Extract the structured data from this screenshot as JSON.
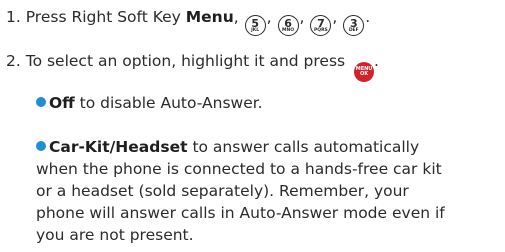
{
  "step1": {
    "number": "1.",
    "text": "Press Right Soft Key",
    "key_label": "Menu",
    "keys": [
      {
        "digit": "5",
        "letters": "JKL"
      },
      {
        "digit": "6",
        "letters": "MNO"
      },
      {
        "digit": "7",
        "letters": "PQRS"
      },
      {
        "digit": "3",
        "letters": "DEF"
      }
    ],
    "separator": ",",
    "end": "."
  },
  "step2": {
    "number": "2.",
    "text": "To select an option, highlight it and press",
    "menu_key": {
      "top": "MENU",
      "bottom": "OK"
    },
    "end": "."
  },
  "options": [
    {
      "label": "Off",
      "description": "to disable Auto-Answer."
    },
    {
      "label": "Car-Kit/Headset",
      "lines": [
        "to answer calls automatically",
        "when the phone is connected to a hands-free car kit",
        "or a headset (sold separately). Remember, your",
        "phone will answer calls in Auto-Answer mode even if",
        "you are not present."
      ]
    }
  ],
  "colors": {
    "bullet": "#1e8fd6",
    "menu_key": "#d2232a",
    "text": "#2b2b2b"
  }
}
